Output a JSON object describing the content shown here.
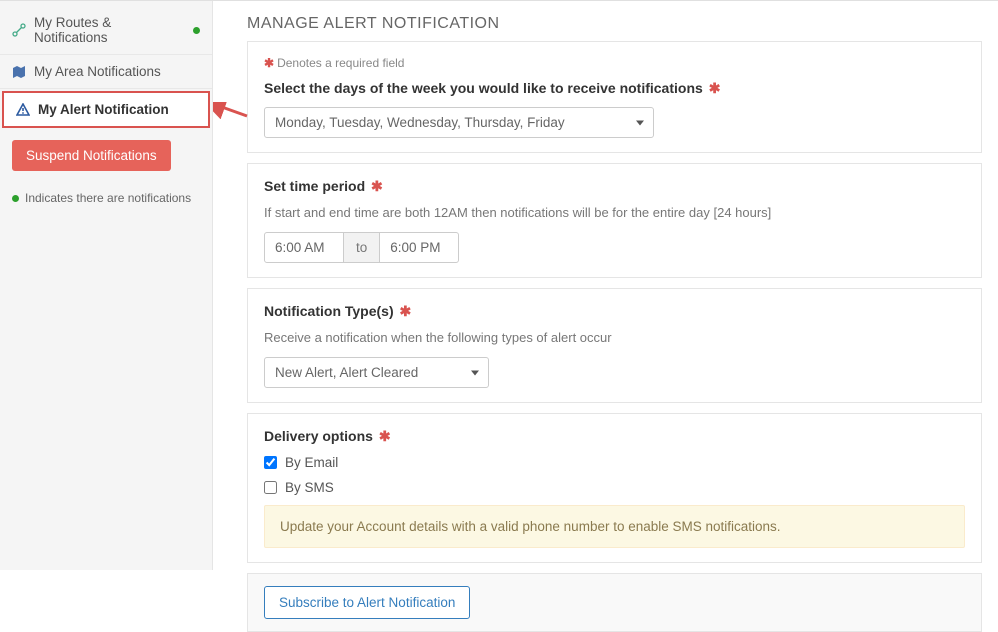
{
  "sidebar": {
    "items": [
      {
        "label": "My Routes & Notifications",
        "has_dot": true
      },
      {
        "label": "My Area Notifications",
        "has_dot": false
      },
      {
        "label": "My Alert Notification",
        "has_dot": false
      }
    ],
    "suspend_label": "Suspend Notifications",
    "legend_text": "Indicates there are notifications"
  },
  "main": {
    "title": "MANAGE ALERT NOTIFICATION",
    "required_note": "Denotes a required field"
  },
  "days": {
    "label": "Select the days of the week you would like to receive notifications",
    "value": "Monday, Tuesday, Wednesday, Thursday, Friday"
  },
  "time": {
    "label": "Set time period",
    "helper": "If start and end time are both 12AM then notifications will be for the entire day [24 hours]",
    "start": "6:00 AM",
    "to": "to",
    "end": "6:00 PM"
  },
  "types": {
    "label": "Notification Type(s)",
    "helper": "Receive a notification when the following types of alert occur",
    "value": "New Alert, Alert Cleared"
  },
  "delivery": {
    "label": "Delivery options",
    "by_email_label": "By Email",
    "by_email_checked": true,
    "by_sms_label": "By SMS",
    "by_sms_checked": false,
    "sms_note": "Update your Account details with a valid phone number to enable SMS notifications."
  },
  "footer": {
    "subscribe_label": "Subscribe to Alert Notification"
  },
  "colors": {
    "accent_red": "#d9534f",
    "accent_blue": "#357ebd",
    "accent_green": "#2ca02c"
  }
}
